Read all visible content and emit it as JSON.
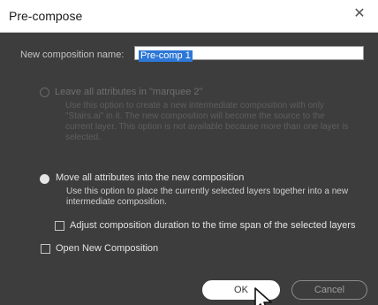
{
  "window": {
    "title": "Pre-compose"
  },
  "name_field": {
    "label": "New composition name:",
    "value": "Pre-comp 1"
  },
  "options": {
    "leave": {
      "label": "Leave all attributes in \"marquee 2\"",
      "description": [
        "Use this option to create a new intermediate composition with only",
        "\"Stairs.ai\" in it. The new composition will become the source to the",
        "current layer. This option is not available because more than one layer is",
        "selected."
      ],
      "enabled": false,
      "selected": false
    },
    "move": {
      "label": "Move all attributes into the new composition",
      "description": [
        "Use this option to place the currently selected layers together into a new",
        "intermediate composition."
      ],
      "enabled": true,
      "selected": true
    },
    "adjust_duration": {
      "label": "Adjust composition duration to the time span of the selected layers",
      "checked": false
    },
    "open_new": {
      "label": "Open New Composition",
      "checked": false
    }
  },
  "buttons": {
    "ok": "OK",
    "cancel": "Cancel"
  },
  "icons": {
    "close": "close-icon",
    "cursor": "mouse-pointer-icon"
  },
  "colors": {
    "dialog_bg": "#3d3d3d",
    "selection": "#2d77d6",
    "titlebar_bg": "#ffffff"
  }
}
